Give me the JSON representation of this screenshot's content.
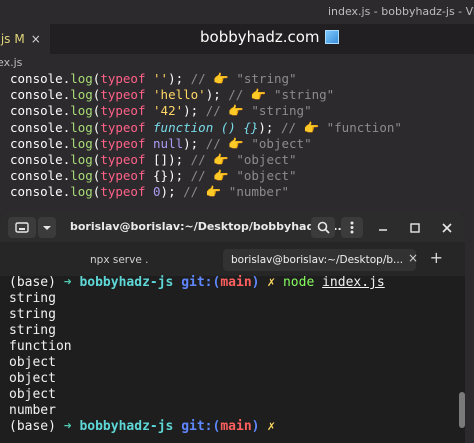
{
  "window": {
    "title": "index.js - bobbyhadz-js - Vi"
  },
  "editor": {
    "tab": {
      "label": ".js",
      "modified": "M",
      "close": "×"
    },
    "brand": "bobbyhadz.com",
    "breadcrumb": "ex.js",
    "lines": [
      {
        "typeof_arg": "''",
        "arg_kind": "str",
        "comment": "\"string\""
      },
      {
        "typeof_arg": "'hello'",
        "arg_kind": "str",
        "comment": "\"string\""
      },
      {
        "typeof_arg": "'42'",
        "arg_kind": "str",
        "comment": "\"string\""
      },
      {
        "typeof_arg": "function () {}",
        "arg_kind": "fn",
        "comment": "\"function\""
      },
      {
        "typeof_arg": "null",
        "arg_kind": "num",
        "comment": "\"object\""
      },
      {
        "typeof_arg": "[]",
        "arg_kind": "plain",
        "comment": "\"object\""
      },
      {
        "typeof_arg": "{}",
        "arg_kind": "plain",
        "comment": "\"object\""
      },
      {
        "typeof_arg": "0",
        "arg_kind": "num",
        "comment": "\"number\""
      }
    ]
  },
  "terminal": {
    "title": "borislav@borislav:~/Desktop/bobbyhadz-r...",
    "tabs": [
      {
        "label": "npx serve ."
      },
      {
        "label": "borislav@borislav:~/Desktop/b..."
      }
    ],
    "prompt": {
      "env": "(base)",
      "arrow": "➜",
      "dir": "bobbyhadz-js",
      "git_open": "git:(",
      "branch": "main",
      "git_close": ")",
      "mark": "✗"
    },
    "command": {
      "cmd": "node",
      "arg": "index.js"
    },
    "output": [
      "string",
      "string",
      "string",
      "function",
      "object",
      "object",
      "object",
      "number"
    ]
  },
  "colors": {
    "editor_bg": "#2d2a2e",
    "terminal_bg": "#1e1e1e",
    "keyword": "#ff6188",
    "function": "#a9dc76",
    "string": "#ffd866"
  }
}
